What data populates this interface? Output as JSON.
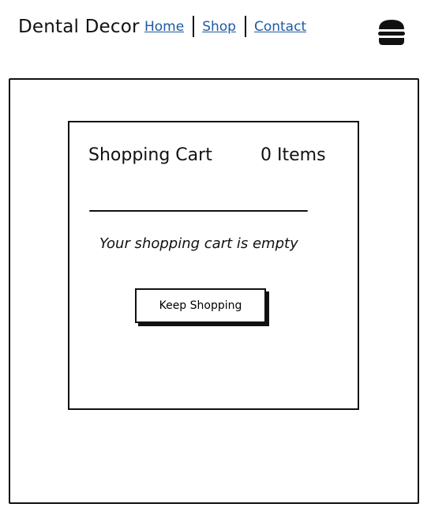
{
  "header": {
    "brand": "Dental Decor",
    "nav": {
      "home": "Home",
      "shop": "Shop",
      "contact": "Contact"
    },
    "menu_icon": "hamburger-icon"
  },
  "cart": {
    "title": "Shopping Cart",
    "count": "0 Items",
    "empty_message": "Your shopping cart is empty",
    "keep_shopping_label": "Keep Shopping"
  },
  "colors": {
    "link": "#1d5aa3",
    "ink": "#111111",
    "background": "#ffffff"
  }
}
